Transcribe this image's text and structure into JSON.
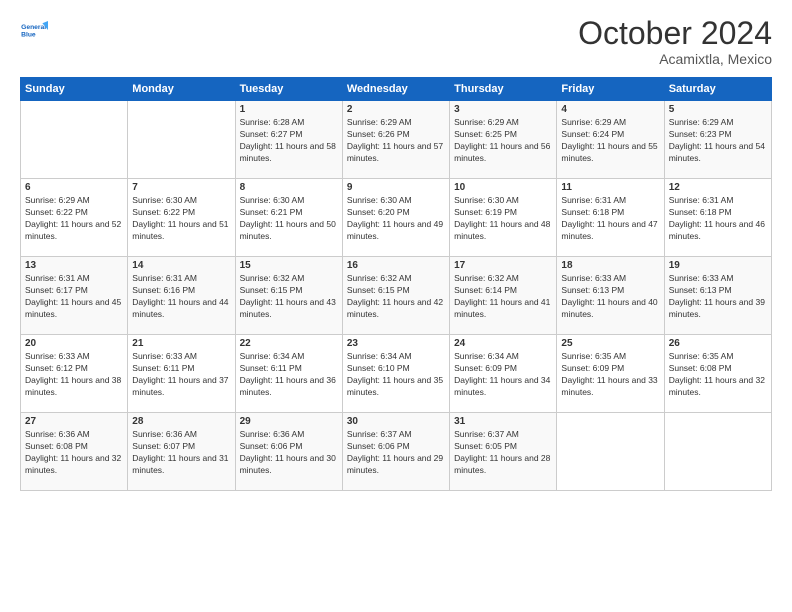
{
  "logo": {
    "line1": "General",
    "line2": "Blue"
  },
  "header": {
    "month": "October 2024",
    "location": "Acamixtla, Mexico"
  },
  "weekdays": [
    "Sunday",
    "Monday",
    "Tuesday",
    "Wednesday",
    "Thursday",
    "Friday",
    "Saturday"
  ],
  "weeks": [
    [
      {
        "day": "",
        "info": ""
      },
      {
        "day": "",
        "info": ""
      },
      {
        "day": "1",
        "info": "Sunrise: 6:28 AM\nSunset: 6:27 PM\nDaylight: 11 hours and 58 minutes."
      },
      {
        "day": "2",
        "info": "Sunrise: 6:29 AM\nSunset: 6:26 PM\nDaylight: 11 hours and 57 minutes."
      },
      {
        "day": "3",
        "info": "Sunrise: 6:29 AM\nSunset: 6:25 PM\nDaylight: 11 hours and 56 minutes."
      },
      {
        "day": "4",
        "info": "Sunrise: 6:29 AM\nSunset: 6:24 PM\nDaylight: 11 hours and 55 minutes."
      },
      {
        "day": "5",
        "info": "Sunrise: 6:29 AM\nSunset: 6:23 PM\nDaylight: 11 hours and 54 minutes."
      }
    ],
    [
      {
        "day": "6",
        "info": "Sunrise: 6:29 AM\nSunset: 6:22 PM\nDaylight: 11 hours and 52 minutes."
      },
      {
        "day": "7",
        "info": "Sunrise: 6:30 AM\nSunset: 6:22 PM\nDaylight: 11 hours and 51 minutes."
      },
      {
        "day": "8",
        "info": "Sunrise: 6:30 AM\nSunset: 6:21 PM\nDaylight: 11 hours and 50 minutes."
      },
      {
        "day": "9",
        "info": "Sunrise: 6:30 AM\nSunset: 6:20 PM\nDaylight: 11 hours and 49 minutes."
      },
      {
        "day": "10",
        "info": "Sunrise: 6:30 AM\nSunset: 6:19 PM\nDaylight: 11 hours and 48 minutes."
      },
      {
        "day": "11",
        "info": "Sunrise: 6:31 AM\nSunset: 6:18 PM\nDaylight: 11 hours and 47 minutes."
      },
      {
        "day": "12",
        "info": "Sunrise: 6:31 AM\nSunset: 6:18 PM\nDaylight: 11 hours and 46 minutes."
      }
    ],
    [
      {
        "day": "13",
        "info": "Sunrise: 6:31 AM\nSunset: 6:17 PM\nDaylight: 11 hours and 45 minutes."
      },
      {
        "day": "14",
        "info": "Sunrise: 6:31 AM\nSunset: 6:16 PM\nDaylight: 11 hours and 44 minutes."
      },
      {
        "day": "15",
        "info": "Sunrise: 6:32 AM\nSunset: 6:15 PM\nDaylight: 11 hours and 43 minutes."
      },
      {
        "day": "16",
        "info": "Sunrise: 6:32 AM\nSunset: 6:15 PM\nDaylight: 11 hours and 42 minutes."
      },
      {
        "day": "17",
        "info": "Sunrise: 6:32 AM\nSunset: 6:14 PM\nDaylight: 11 hours and 41 minutes."
      },
      {
        "day": "18",
        "info": "Sunrise: 6:33 AM\nSunset: 6:13 PM\nDaylight: 11 hours and 40 minutes."
      },
      {
        "day": "19",
        "info": "Sunrise: 6:33 AM\nSunset: 6:13 PM\nDaylight: 11 hours and 39 minutes."
      }
    ],
    [
      {
        "day": "20",
        "info": "Sunrise: 6:33 AM\nSunset: 6:12 PM\nDaylight: 11 hours and 38 minutes."
      },
      {
        "day": "21",
        "info": "Sunrise: 6:33 AM\nSunset: 6:11 PM\nDaylight: 11 hours and 37 minutes."
      },
      {
        "day": "22",
        "info": "Sunrise: 6:34 AM\nSunset: 6:11 PM\nDaylight: 11 hours and 36 minutes."
      },
      {
        "day": "23",
        "info": "Sunrise: 6:34 AM\nSunset: 6:10 PM\nDaylight: 11 hours and 35 minutes."
      },
      {
        "day": "24",
        "info": "Sunrise: 6:34 AM\nSunset: 6:09 PM\nDaylight: 11 hours and 34 minutes."
      },
      {
        "day": "25",
        "info": "Sunrise: 6:35 AM\nSunset: 6:09 PM\nDaylight: 11 hours and 33 minutes."
      },
      {
        "day": "26",
        "info": "Sunrise: 6:35 AM\nSunset: 6:08 PM\nDaylight: 11 hours and 32 minutes."
      }
    ],
    [
      {
        "day": "27",
        "info": "Sunrise: 6:36 AM\nSunset: 6:08 PM\nDaylight: 11 hours and 32 minutes."
      },
      {
        "day": "28",
        "info": "Sunrise: 6:36 AM\nSunset: 6:07 PM\nDaylight: 11 hours and 31 minutes."
      },
      {
        "day": "29",
        "info": "Sunrise: 6:36 AM\nSunset: 6:06 PM\nDaylight: 11 hours and 30 minutes."
      },
      {
        "day": "30",
        "info": "Sunrise: 6:37 AM\nSunset: 6:06 PM\nDaylight: 11 hours and 29 minutes."
      },
      {
        "day": "31",
        "info": "Sunrise: 6:37 AM\nSunset: 6:05 PM\nDaylight: 11 hours and 28 minutes."
      },
      {
        "day": "",
        "info": ""
      },
      {
        "day": "",
        "info": ""
      }
    ]
  ]
}
